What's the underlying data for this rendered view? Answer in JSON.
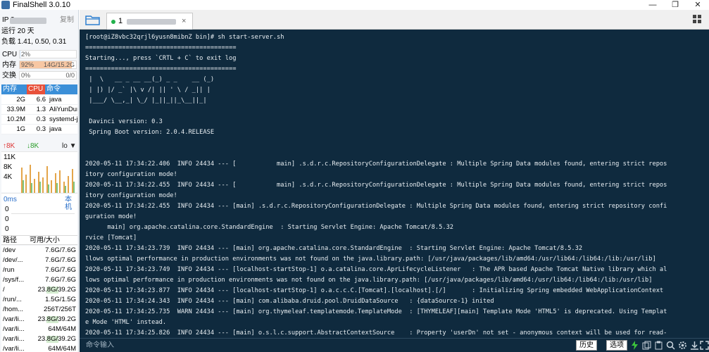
{
  "window": {
    "title": "FinalShell 3.0.10",
    "minimize": "—",
    "restore": "❐",
    "close": "✕"
  },
  "sidebar": {
    "ip_label": "IP 3",
    "copy_label": "复制",
    "uptime": "运行 20 天",
    "load": "负载 1.41, 0.50, 0.31",
    "cpu": {
      "label": "CPU",
      "value": "2%",
      "fraction": 0.02
    },
    "mem": {
      "label": "内存",
      "percent": "92%",
      "detail": "14G/15.2G",
      "fraction": 0.92
    },
    "swap": {
      "label": "交换",
      "percent": "0%",
      "detail": "0/0",
      "fraction": 0.0
    },
    "proc_headers": {
      "mem": "内存",
      "cpu": "CPU",
      "cmd": "命令"
    },
    "processes": [
      {
        "mem": "2G",
        "cpu": "6.6",
        "cmd": "java"
      },
      {
        "mem": "33.9M",
        "cpu": "1.3",
        "cmd": "AliYunDun"
      },
      {
        "mem": "10.2M",
        "cpu": "0.3",
        "cmd": "systemd-j"
      },
      {
        "mem": "1G",
        "cpu": "0.3",
        "cmd": "java"
      }
    ],
    "net": {
      "up": "8K",
      "down": "8K",
      "iface": "lo",
      "scale": [
        "11K",
        "8K",
        "4K"
      ]
    },
    "ping": {
      "ms": "0ms",
      "host": "本机",
      "values": [
        "0",
        "0",
        "0"
      ]
    },
    "disk_headers": {
      "path": "路径",
      "size": "可用/大小"
    },
    "disks": [
      {
        "path": "/dev",
        "size": "7.6G/7.6G",
        "used": 0.0
      },
      {
        "path": "/dev/...",
        "size": "7.6G/7.6G",
        "used": 0.0
      },
      {
        "path": "/run",
        "size": "7.6G/7.6G",
        "used": 0.0
      },
      {
        "path": "/sys/f...",
        "size": "7.6G/7.6G",
        "used": 0.0
      },
      {
        "path": "/",
        "size": "23.8G/39.2G",
        "used": 0.39
      },
      {
        "path": "/run/...",
        "size": "1.5G/1.5G",
        "used": 0.0
      },
      {
        "path": "/hom...",
        "size": "256T/256T",
        "used": 0.0
      },
      {
        "path": "/var/li...",
        "size": "23.8G/39.2G",
        "used": 0.39
      },
      {
        "path": "/var/li...",
        "size": "64M/64M",
        "used": 0.0
      },
      {
        "path": "/var/li...",
        "size": "23.8G/39.2G",
        "used": 0.39
      },
      {
        "path": "/var/li...",
        "size": "64M/64M",
        "used": 0.0
      }
    ]
  },
  "tab": {
    "index": "1",
    "close": "×"
  },
  "terminal": {
    "lines": [
      "[root@iZ8vbc32qrjl6yusn8mibnZ bin]# sh start-server.sh",
      "=========================================",
      "Starting..., press `CRTL + C` to exit log",
      "=========================================",
      " |  \\   __ _ __ __(_) _ _    __ (_)",
      " | |) |/ _` |\\ v /| || ' \\ / _|| |",
      " |___/ \\__,_| \\_/ |_||_||_\\__||_|",
      "",
      " Davinci version: 0.3",
      " Spring Boot version: 2.0.4.RELEASE",
      "",
      "",
      "2020-05-11 17:34:22.406  INFO 24434 --- [           main] .s.d.r.c.RepositoryConfigurationDelegate : Multiple Spring Data modules found, entering strict repos",
      "itory configuration mode!",
      "2020-05-11 17:34:22.455  INFO 24434 --- [           main] .s.d.r.c.RepositoryConfigurationDelegate : Multiple Spring Data modules found, entering strict repos",
      "itory configuration mode!",
      "2020-05-11 17:34:22.455  INFO 24434 --- [main] .s.d.r.c.RepositoryConfigurationDelegate : Multiple Spring Data modules found, entering strict repository confi",
      "guration mode!",
      "      main] org.apache.catalina.core.StandardEngine  : Starting Servlet Engine: Apache Tomcat/8.5.32",
      "rvice [Tomcat]",
      "2020-05-11 17:34:23.739  INFO 24434 --- [main] org.apache.catalina.core.StandardEngine  : Starting Servlet Engine: Apache Tomcat/8.5.32",
      "llows optimal performance in production environments was not found on the java.library.path: [/usr/java/packages/lib/amd64:/usr/lib64:/lib64:/lib:/usr/lib]",
      "2020-05-11 17:34:23.749  INFO 24434 --- [localhost-startStop-1] o.a.catalina.core.AprLifecycleListener   : The APR based Apache Tomcat Native library which al",
      "lows optimal performance in production environments was not found on the java.library.path: [/usr/java/packages/lib/amd64:/usr/lib64:/lib64:/lib:/usr/lib]",
      "2020-05-11 17:34:23.877  INFO 24434 --- [localhost-startStop-1] o.a.c.c.C.[Tomcat].[localhost].[/]       : Initializing Spring embedded WebApplicationContext",
      "2020-05-11 17:34:24.343  INFO 24434 --- [main] com.alibaba.druid.pool.DruidDataSource   : {dataSource-1} inited",
      "2020-05-11 17:34:25.735  WARN 24434 --- [main] org.thymeleaf.templatemode.TemplateMode  : [THYMELEAF][main] Template Mode 'HTML5' is deprecated. Using Templat",
      "e Mode 'HTML' instead.",
      "2020-05-11 17:34:25.826  INFO 24434 --- [main] o.s.l.c.support.AbstractContextSource    : Property 'userDn' not set - anonymous context will be used for read-"
    ]
  },
  "cmdbar": {
    "placeholder": "命令输入",
    "history": "历史",
    "options": "选项"
  },
  "colors": {
    "terminal_bg": "#0f2a3e",
    "cpu_fill": "#e6f0fa",
    "mem_fill": "#f7c7a3",
    "accent_blue": "#3b8fd8",
    "accent_red": "#e8503a"
  }
}
